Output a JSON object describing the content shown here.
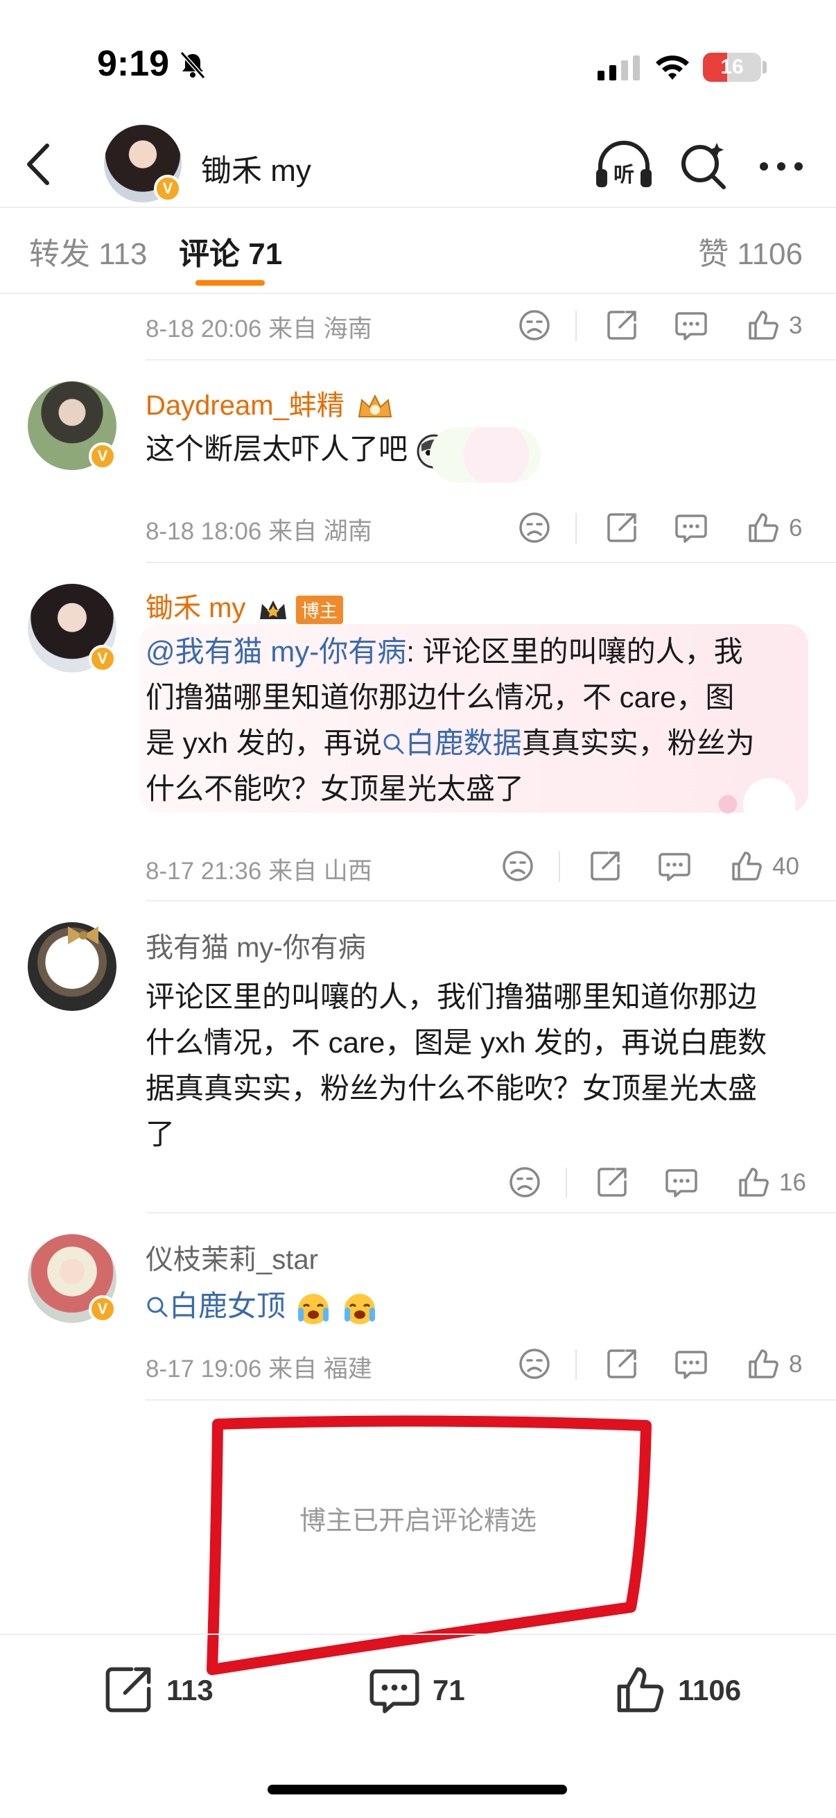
{
  "status_bar": {
    "time": "9:19",
    "battery": "16",
    "battery_level": 0.16
  },
  "header": {
    "name": "锄禾 my",
    "verified": "V"
  },
  "tabs": {
    "repost": "转发 113",
    "comment": "评论 71",
    "like": "赞 1106"
  },
  "comments": [
    {
      "meta": "8-18 20:06 来自 海南",
      "likes": "3"
    },
    {
      "name": "Daydream_蚌精",
      "text": "这个断层太吓人了吧",
      "meta": "8-18 18:06 来自 湖南",
      "likes": "6"
    },
    {
      "name": "锄禾 my",
      "host_badge": "博主",
      "mention": "@我有猫 my-你有病",
      "line1_rest": ": 评论区里的叫嚷的人，我",
      "line2": "们撸猫哪里知道你那边什么情况，不 care，图",
      "line3_a": "是 yxh 发的，再说",
      "topic": "白鹿数据",
      "line3_b": "真真实实，粉丝为",
      "line4": "什么不能吹？女顶星光太盛了",
      "meta": "8-17 21:36 来自 山西",
      "likes": "40"
    },
    {
      "name": "我有猫 my-你有病",
      "line1": "评论区里的叫嚷的人，我们撸猫哪里知道你那边",
      "line2": "什么情况，不 care，图是 yxh 发的，再说白鹿数",
      "line3": "据真真实实，粉丝为什么不能吹？女顶星光太盛",
      "line4": "了",
      "likes": "16"
    },
    {
      "name": "仪枝茉莉_star",
      "topic": "白鹿女顶",
      "meta": "8-17 19:06 来自 福建",
      "likes": "8"
    }
  ],
  "selection_note": "博主已开启评论精选",
  "bottom_bar": {
    "repost": "113",
    "comment": "71",
    "like": "1106"
  },
  "colors": {
    "accent": "#ff8200",
    "name_orange": "#e86c00",
    "link_blue": "#3a6ab0",
    "annotation_red": "#e0101e"
  },
  "icons": [
    "bell-off-icon",
    "signal-icon",
    "wifi-icon",
    "back-icon",
    "listen-icon",
    "search-icon",
    "more-icon",
    "dislike-icon",
    "share-icon",
    "comment-icon",
    "like-icon"
  ]
}
